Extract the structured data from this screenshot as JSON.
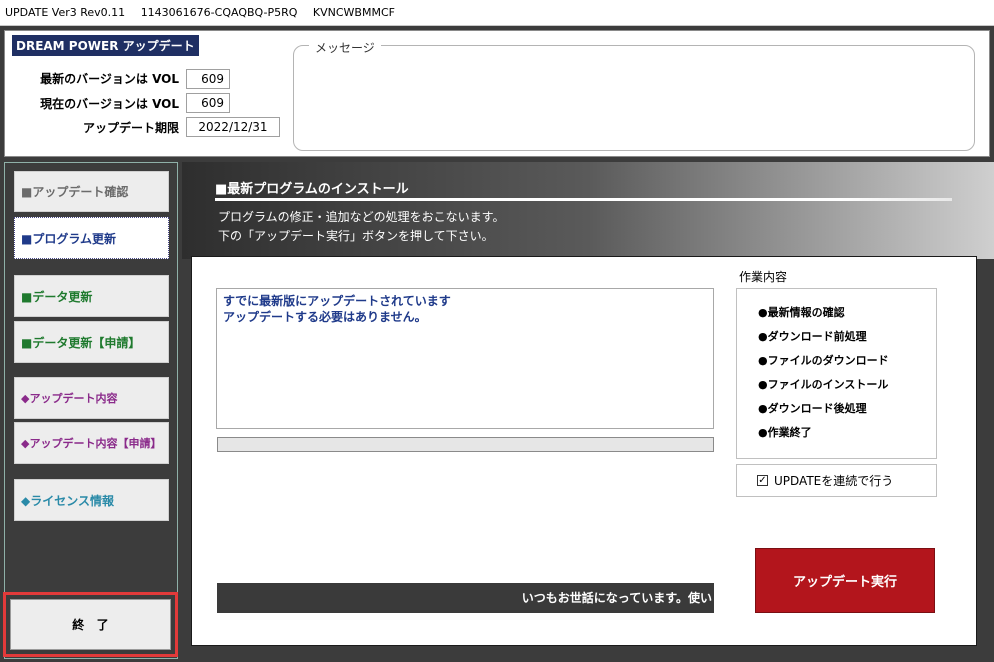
{
  "window": {
    "title": "UPDATE Ver3 Rev0.11",
    "id_code": "1143061676-CQAQBQ-P5RQ",
    "machine_code": "KVNCWBMMCF"
  },
  "header": {
    "app_title": "DREAM POWER アップデート",
    "latest_label": "最新のバージョンは VOL",
    "latest_value": "609",
    "current_label": "現在のバージョンは VOL",
    "current_value": "609",
    "deadline_label": "アップデート期限",
    "deadline_value": "2022/12/31",
    "message_legend": "メッセージ"
  },
  "nav": {
    "items": [
      {
        "label": "■アップデート確認",
        "color": "#6b6b6b"
      },
      {
        "label": "■プログラム更新",
        "color": "#1f3a8a"
      },
      {
        "label": "■データ更新",
        "color": "#1f7a2e"
      },
      {
        "label": "■データ更新【申請】",
        "color": "#1f7a2e"
      },
      {
        "label": "◆アップデート内容",
        "color": "#8a2a8a"
      },
      {
        "label": "◆アップデート内容【申請】",
        "color": "#8a2a8a"
      },
      {
        "label": "◆ライセンス情報",
        "color": "#2a8aa8"
      }
    ],
    "exit_label": "終　了"
  },
  "main": {
    "section_title": "■最新プログラムのインストール",
    "desc1": "プログラムの修正・追加などの処理をおこないます。",
    "desc2": "下の「アップデート実行」ボタンを押して下さい。",
    "status_line1": "すでに最新版にアップデートされています",
    "status_line2": "アップデートする必要はありません。",
    "ticker": "いつもお世話になっています。使い",
    "tasks_title": "作業内容",
    "tasks": [
      "●最新情報の確認",
      "●ダウンロード前処理",
      "●ファイルのダウンロード",
      "●ファイルのインストール",
      "●ダウンロード後処理",
      "●作業終了"
    ],
    "continuous_label": "UPDATEを連続で行う",
    "continuous_checked": "✓",
    "run_button": "アップデート実行"
  }
}
